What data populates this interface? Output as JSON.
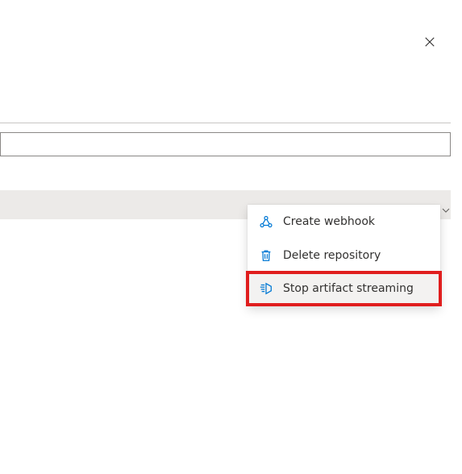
{
  "close_label": "Close",
  "menu": {
    "items": [
      {
        "label": "Create webhook",
        "icon": "webhook-icon"
      },
      {
        "label": "Delete repository",
        "icon": "delete-icon"
      },
      {
        "label": "Stop artifact streaming",
        "icon": "stream-stop-icon"
      }
    ],
    "highlight_index": 2
  },
  "colors": {
    "accent": "#0078d4",
    "highlight_border": "#e01e1e"
  }
}
